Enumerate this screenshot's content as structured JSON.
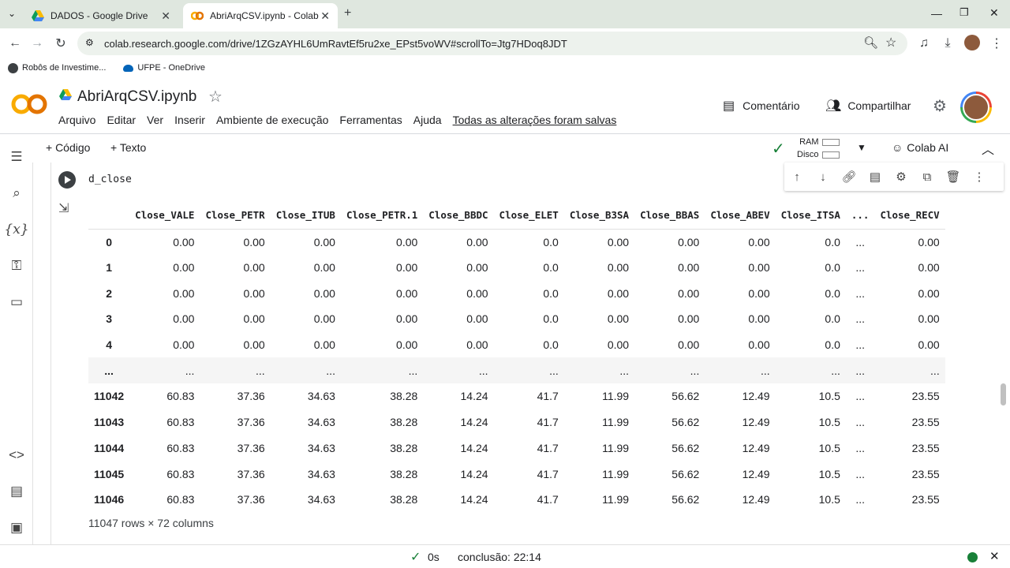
{
  "browser": {
    "tabs": [
      {
        "title": "DADOS - Google Drive"
      },
      {
        "title": "AbriArqCSV.ipynb - Colab"
      }
    ],
    "url": "colab.research.google.com/drive/1ZGzAYHL6UmRavtEf5ru2xe_EPst5voWV#scrollTo=Jtg7HDoq8JDT",
    "bookmarks": [
      "Robôs de Investime...",
      "UFPE - OneDrive"
    ]
  },
  "colab": {
    "logo_text": "CO",
    "notebook_title": "AbriArqCSV.ipynb",
    "menus": [
      "Arquivo",
      "Editar",
      "Ver",
      "Inserir",
      "Ambiente de execução",
      "Ferramentas",
      "Ajuda"
    ],
    "saved_status": "Todas as alterações foram salvas",
    "comment_label": "Comentário",
    "share_label": "Compartilhar"
  },
  "toolbar": {
    "add_code": "+ Código",
    "add_text": "+ Texto",
    "ram_label": "RAM",
    "disk_label": "Disco",
    "colab_ai": "Colab AI"
  },
  "cell": {
    "code": "d_close"
  },
  "table": {
    "columns": [
      "",
      "Close_VALE",
      "Close_PETR",
      "Close_ITUB",
      "Close_PETR.1",
      "Close_BBDC",
      "Close_ELET",
      "Close_B3SA",
      "Close_BBAS",
      "Close_ABEV",
      "Close_ITSA",
      "...",
      "Close_RECV"
    ],
    "rows": [
      [
        "0",
        "0.00",
        "0.00",
        "0.00",
        "0.00",
        "0.00",
        "0.0",
        "0.00",
        "0.00",
        "0.00",
        "0.0",
        "...",
        "0.00"
      ],
      [
        "1",
        "0.00",
        "0.00",
        "0.00",
        "0.00",
        "0.00",
        "0.0",
        "0.00",
        "0.00",
        "0.00",
        "0.0",
        "...",
        "0.00"
      ],
      [
        "2",
        "0.00",
        "0.00",
        "0.00",
        "0.00",
        "0.00",
        "0.0",
        "0.00",
        "0.00",
        "0.00",
        "0.0",
        "...",
        "0.00"
      ],
      [
        "3",
        "0.00",
        "0.00",
        "0.00",
        "0.00",
        "0.00",
        "0.0",
        "0.00",
        "0.00",
        "0.00",
        "0.0",
        "...",
        "0.00"
      ],
      [
        "4",
        "0.00",
        "0.00",
        "0.00",
        "0.00",
        "0.00",
        "0.0",
        "0.00",
        "0.00",
        "0.00",
        "0.0",
        "...",
        "0.00"
      ],
      [
        "...",
        "...",
        "...",
        "...",
        "...",
        "...",
        "...",
        "...",
        "...",
        "...",
        "...",
        "...",
        "..."
      ],
      [
        "11042",
        "60.83",
        "37.36",
        "34.63",
        "38.28",
        "14.24",
        "41.7",
        "11.99",
        "56.62",
        "12.49",
        "10.5",
        "...",
        "23.55"
      ],
      [
        "11043",
        "60.83",
        "37.36",
        "34.63",
        "38.28",
        "14.24",
        "41.7",
        "11.99",
        "56.62",
        "12.49",
        "10.5",
        "...",
        "23.55"
      ],
      [
        "11044",
        "60.83",
        "37.36",
        "34.63",
        "38.28",
        "14.24",
        "41.7",
        "11.99",
        "56.62",
        "12.49",
        "10.5",
        "...",
        "23.55"
      ],
      [
        "11045",
        "60.83",
        "37.36",
        "34.63",
        "38.28",
        "14.24",
        "41.7",
        "11.99",
        "56.62",
        "12.49",
        "10.5",
        "...",
        "23.55"
      ],
      [
        "11046",
        "60.83",
        "37.36",
        "34.63",
        "38.28",
        "14.24",
        "41.7",
        "11.99",
        "56.62",
        "12.49",
        "10.5",
        "...",
        "23.55"
      ]
    ],
    "shape_text": "11047 rows × 72 columns"
  },
  "status": {
    "duration": "0s",
    "completion": "conclusão: 22:14"
  },
  "colors": {
    "accent_orange": "#f9ab00",
    "check_green": "#188038",
    "status_dot": "#188038"
  }
}
